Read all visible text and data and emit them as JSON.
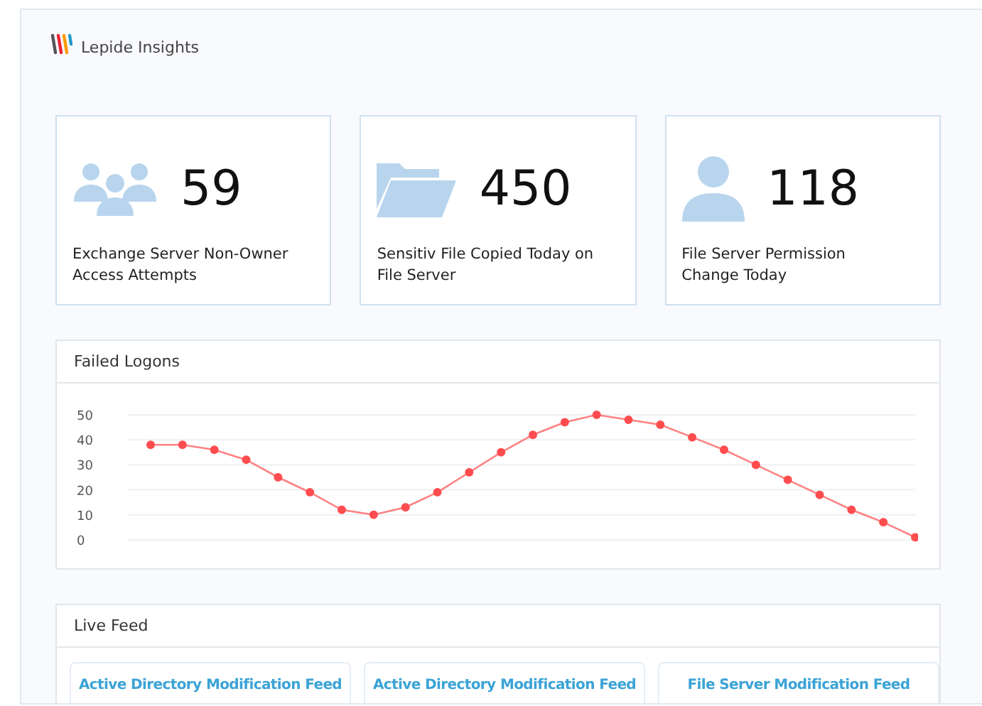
{
  "header": {
    "title": "Lepide Insights"
  },
  "stats": [
    {
      "kind": "group",
      "value": "59",
      "label": "Exchange Server Non-Owner Access Attempts"
    },
    {
      "kind": "folder",
      "value": "450",
      "label": "Sensitiv File Copied Today on File Server"
    },
    {
      "kind": "person",
      "value": "118",
      "label": "File Server Permission Change Today"
    }
  ],
  "failed_logons": {
    "title": "Failed Logons",
    "chart_data": {
      "type": "line",
      "grid": true,
      "ylim": [
        0,
        50
      ],
      "yticks": [
        0,
        10,
        20,
        30,
        40,
        50
      ],
      "series": [
        {
          "color": "#ff4d4f",
          "marker": "circle",
          "values": [
            38,
            38,
            36,
            32,
            25,
            19,
            12,
            10,
            13,
            19,
            27,
            35,
            42,
            47,
            50,
            48,
            46,
            41,
            36,
            30,
            24,
            18,
            12,
            7,
            1
          ]
        }
      ]
    }
  },
  "live_feed": {
    "title": "Live Feed",
    "feeds": [
      "Active Directory Modification Feed",
      "Active Directory Modification Feed",
      "File Server Modification Feed"
    ]
  }
}
